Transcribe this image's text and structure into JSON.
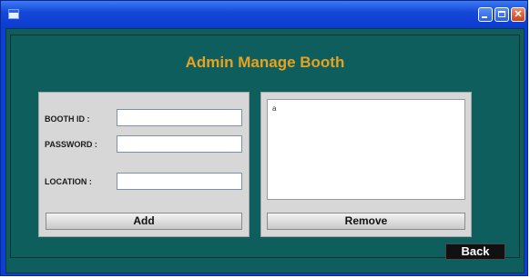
{
  "window": {
    "title": "",
    "controls": {
      "minimize": "",
      "maximize": "",
      "close": "✕"
    }
  },
  "heading": "Admin Manage Booth",
  "form": {
    "booth_id_label": "BOOTH ID :",
    "booth_id_value": "",
    "password_label": "PASSWORD :",
    "password_value": "",
    "location_label": "LOCATION :",
    "location_value": "",
    "add_label": "Add"
  },
  "list_panel": {
    "items": [
      "a"
    ],
    "remove_label": "Remove"
  },
  "back_label": "Back",
  "colors": {
    "window_blue": "#0b3fd6",
    "content_teal": "#0f5e5e",
    "heading_orange": "#e8a21f",
    "panel_gray": "#d7d7d7"
  }
}
